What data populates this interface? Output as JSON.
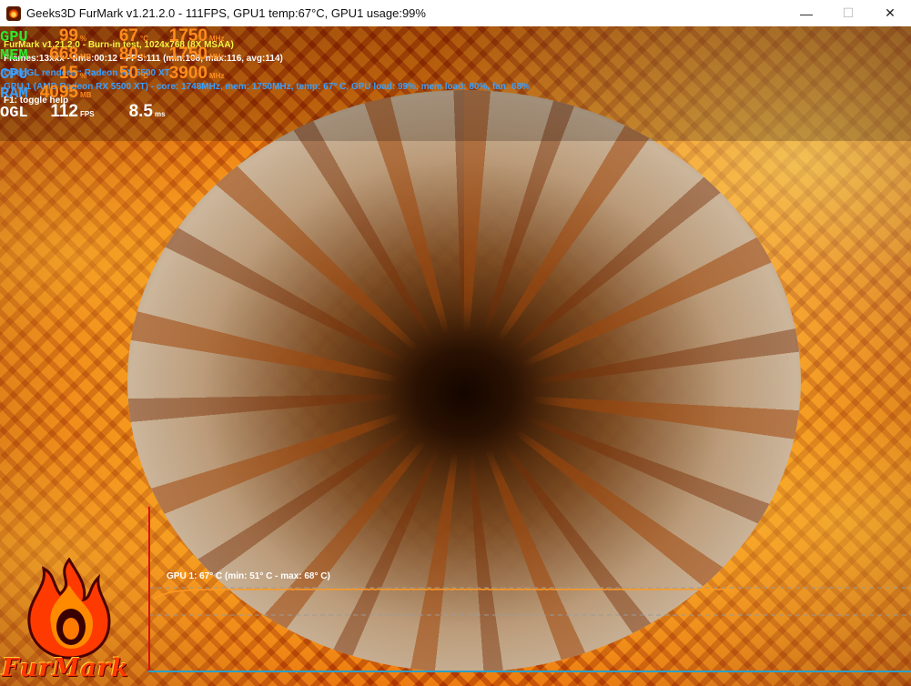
{
  "window": {
    "title": "Geeks3D FurMark v1.21.2.0 - 111FPS, GPU1 temp:67°C, GPU1 usage:99%",
    "minimize_symbol": "—",
    "maximize_symbol": "☐",
    "close_symbol": "✕"
  },
  "monitor": [
    {
      "label": "GPU",
      "value1": "99",
      "unit1": "%",
      "value2": "67",
      "unit2": "°C",
      "value3": "1750",
      "unit3": "MHz"
    },
    {
      "label": "MEM",
      "value1": "668",
      "unit1": "MB",
      "value2": "80",
      "unit2": "%",
      "value3": "1750",
      "unit3": "MHz"
    },
    {
      "label": "CPU",
      "value1": "15",
      "unit1": "%",
      "value2": "50",
      "unit2": "°C",
      "value3": "3900",
      "unit3": "MHz"
    },
    {
      "label": "RAM",
      "value1": "4095",
      "unit1": "MB",
      "value2": "",
      "unit2": "",
      "value3": "",
      "unit3": ""
    },
    {
      "label": "OGL",
      "value1": "112",
      "unit1": "FPS",
      "value2": "8.5",
      "unit2": "ms",
      "value3": "",
      "unit3": ""
    }
  ],
  "info": {
    "line1": "FurMark v1.21.2.0 - Burn-in test, 1024x768 (8X MSAA)",
    "line2": "Frames:13xxx - time:00:12 - FPS:111 (min:108, max:116, avg:114)",
    "line3": "OpenGL renderer: Radeon RX 5500 XT",
    "line4": "GPU 1 (AMD Radeon RX 5500 XT) - core: 1748MHz, mem: 1750MHz, temp: 67° C, GPU load: 99%, mem load: 80%, fan: 68%",
    "line5": "F1: toggle help"
  },
  "graph": {
    "label": "GPU 1: 67° C (min: 51° C - max: 68° C)",
    "current_temp": 67,
    "min_temp": 51,
    "max_temp": 68
  },
  "logo": {
    "text": "FurMark"
  },
  "colors": {
    "accent": "#ff8c1a",
    "graph_line": "#ff9a20",
    "axis_left": "#dd1111",
    "axis_bottom": "#2aa0c8"
  }
}
